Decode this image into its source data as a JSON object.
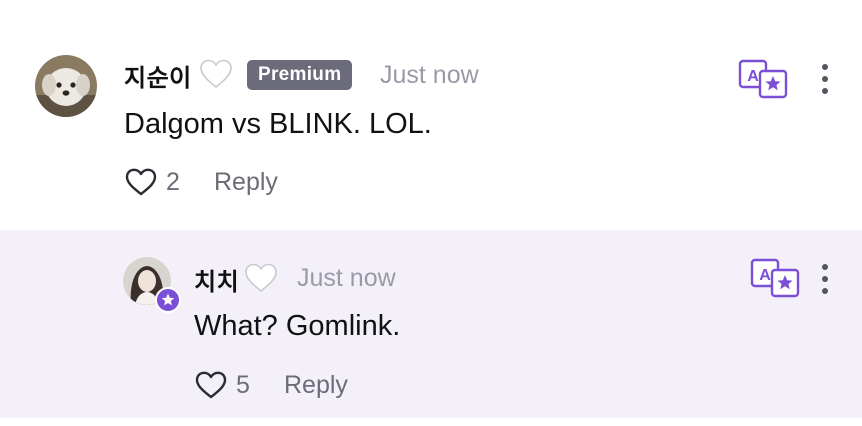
{
  "comments": [
    {
      "author": "지순이",
      "badge": "Premium",
      "time": "Just now",
      "text": "Dalgom vs BLINK. LOL.",
      "likes": "2",
      "reply_label": "Reply"
    },
    {
      "author": "치치",
      "time": "Just now",
      "text": "What? Gomlink.",
      "likes": "5",
      "reply_label": "Reply"
    }
  ],
  "colors": {
    "accent": "#7b4fd6",
    "reply_background": "#f3f0f9",
    "premium_badge": "#6b6b7b",
    "muted_text": "#9a9aa6"
  },
  "icons": [
    "white-heart-icon",
    "heart-outline-icon",
    "translate-icon",
    "more-vertical-icon",
    "star-badge-icon"
  ]
}
